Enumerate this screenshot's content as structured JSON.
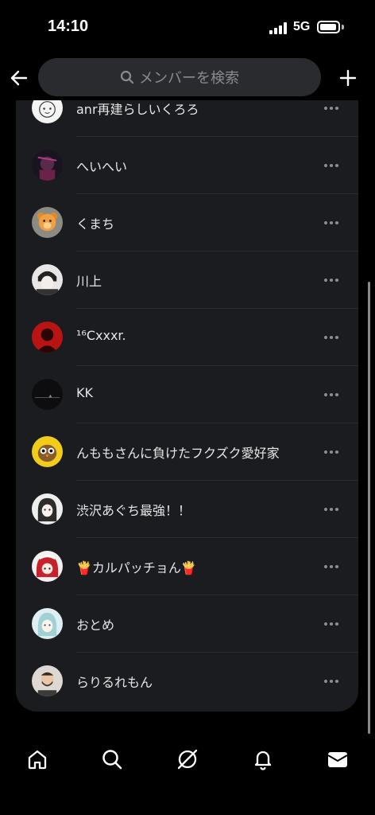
{
  "status_bar": {
    "time": "14:10",
    "network": "5G"
  },
  "header": {
    "back_icon": "arrow-left-icon",
    "search_placeholder": "メンバーを検索",
    "add_icon": "plus-icon"
  },
  "members": [
    {
      "name": "anr再建らしいくろろ",
      "avatar": "sketch-character"
    },
    {
      "name": "へいへい",
      "avatar": "dark-anime-character"
    },
    {
      "name": "くまち",
      "avatar": "teddy-bear"
    },
    {
      "name": "川上",
      "avatar": "monochrome-anime"
    },
    {
      "name": "¹⁶Cxxxr.",
      "avatar": "red-silhouette"
    },
    {
      "name": "KK",
      "avatar": "dark-landscape"
    },
    {
      "name": "んももさんに負けたフクズク愛好家",
      "avatar": "owl-yellow"
    },
    {
      "name": "渋沢あぐち最強！！",
      "avatar": "anime-girl"
    },
    {
      "name": "🍟カルパッチョん🍟",
      "avatar": "red-hair-maid"
    },
    {
      "name": "おとめ",
      "avatar": "teal-hair-girl"
    },
    {
      "name": "らりるれもん",
      "avatar": "bearded-man"
    }
  ],
  "bottom_nav": [
    {
      "icon": "home-icon"
    },
    {
      "icon": "search-icon"
    },
    {
      "icon": "compass-icon"
    },
    {
      "icon": "bell-icon"
    },
    {
      "icon": "inbox-icon"
    }
  ],
  "colors": {
    "background": "#000000",
    "panel": "#1b1c1f",
    "search": "#2a2b2f",
    "text": "#e6e6e8",
    "muted": "#8a8b90"
  }
}
